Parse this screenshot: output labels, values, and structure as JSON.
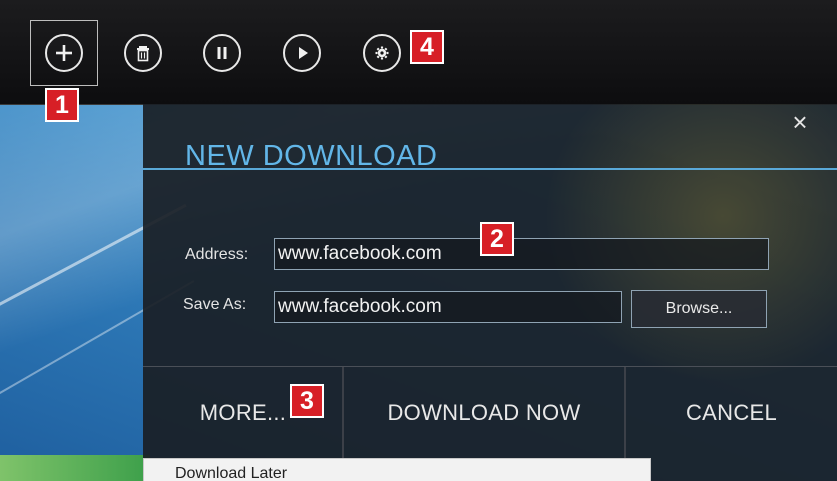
{
  "toolbar": {
    "buttons": [
      {
        "icon": "plus-icon",
        "label": "Add"
      },
      {
        "icon": "trash-icon",
        "label": "Delete"
      },
      {
        "icon": "pause-icon",
        "label": "Pause"
      },
      {
        "icon": "play-icon",
        "label": "Resume"
      },
      {
        "icon": "gear-icon",
        "label": "Settings"
      }
    ]
  },
  "callouts": [
    "1",
    "2",
    "3",
    "4"
  ],
  "dialog": {
    "title": "NEW DOWNLOAD",
    "close_glyph": "×",
    "address_label": "Address:",
    "address_value": "www.facebook.com",
    "save_as_label": "Save As:",
    "save_as_value": "www.facebook.com",
    "browse_label": "Browse...",
    "more_label": "MORE...",
    "download_now_label": "DOWNLOAD NOW",
    "cancel_label": "CANCEL",
    "dropdown_items": [
      "Download Later"
    ]
  },
  "colors": {
    "title": "#62b6e8",
    "callout": "#d71f26",
    "rule": "#5aa9d8"
  }
}
